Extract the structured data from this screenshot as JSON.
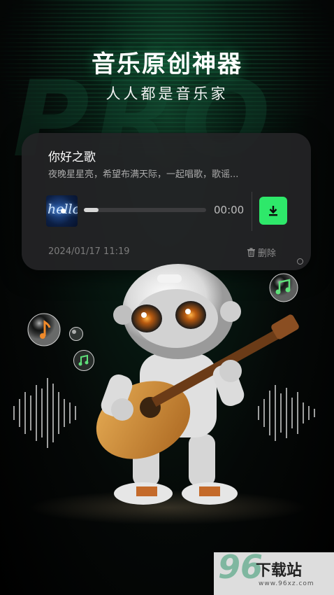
{
  "hero": {
    "title": "音乐原创神器",
    "subtitle": "人人都是音乐家",
    "background_word": "PRO"
  },
  "song_card": {
    "title": "你好之歌",
    "lyrics": "夜晚星星亮，希望布满天际，一起唱歌，歌谣...",
    "thumbnail_text": "hello",
    "progress": 0.12,
    "time": "00:00",
    "date": "2024/01/17 11:19",
    "delete_label": "删除",
    "download_icon": "download-icon",
    "accent_color": "#2ee86a"
  },
  "watermark": {
    "number": "96",
    "text": "下载站",
    "url": "www.96xz.com"
  }
}
